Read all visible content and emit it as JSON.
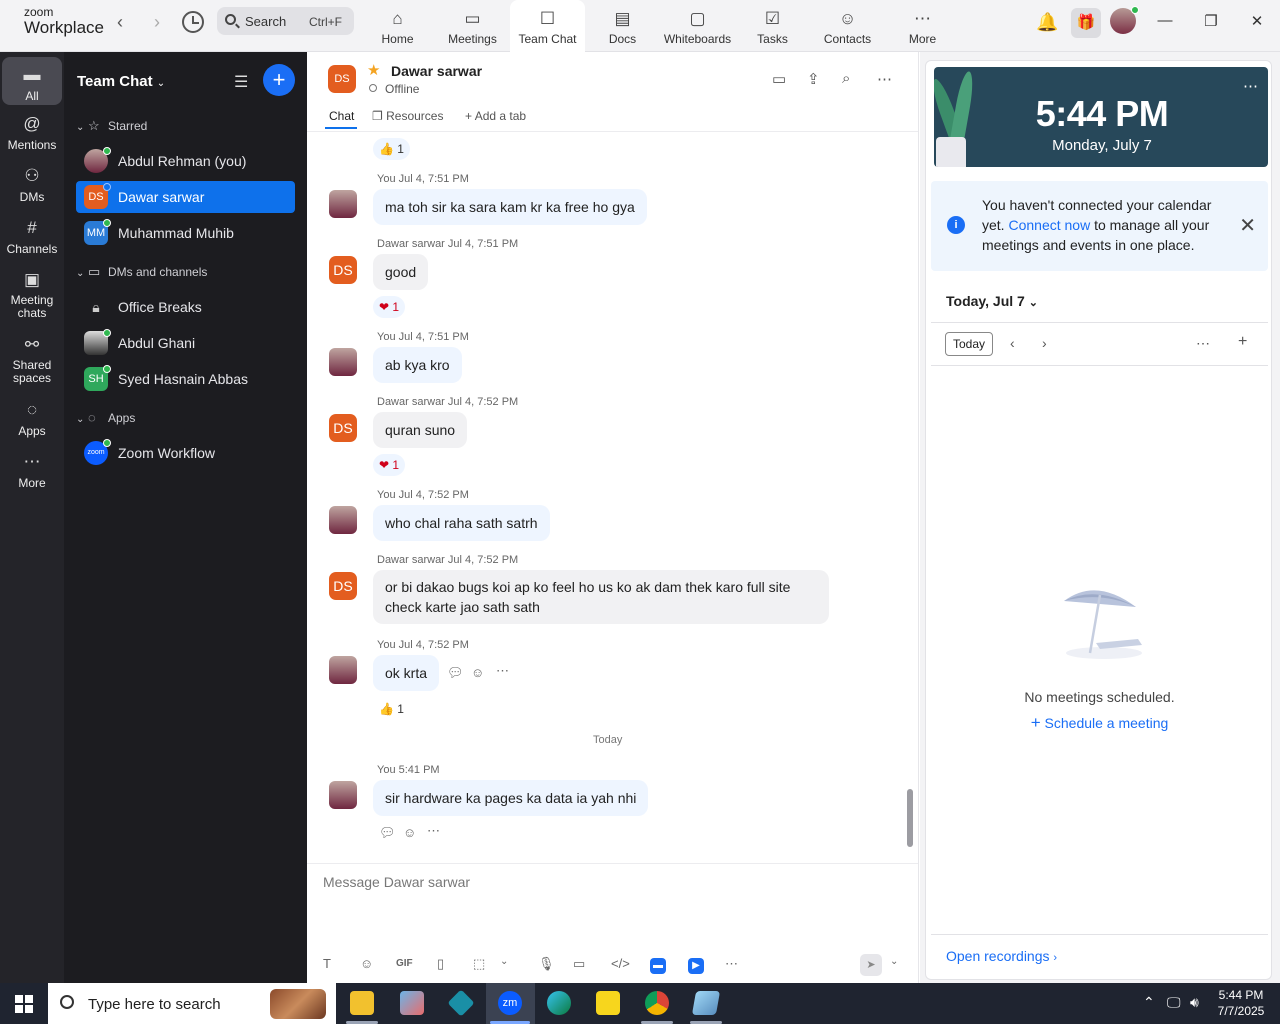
{
  "app": {
    "logo_line1": "zoom",
    "logo_line2": "Workplace"
  },
  "search": {
    "label": "Search",
    "shortcut": "Ctrl+F"
  },
  "topnav": [
    {
      "label": "Home",
      "icon": "home-icon"
    },
    {
      "label": "Meetings",
      "icon": "video-icon"
    },
    {
      "label": "Team Chat",
      "icon": "chat-icon",
      "active": true
    },
    {
      "label": "Docs",
      "icon": "doc-icon"
    },
    {
      "label": "Whiteboards",
      "icon": "whiteboard-icon"
    },
    {
      "label": "Tasks",
      "icon": "tasks-icon"
    },
    {
      "label": "Contacts",
      "icon": "contacts-icon"
    },
    {
      "label": "More",
      "icon": "more-icon"
    }
  ],
  "rail": [
    {
      "label": "All",
      "icon": "chat-bubble-icon",
      "active": true
    },
    {
      "label": "Mentions",
      "icon": "at-icon"
    },
    {
      "label": "DMs",
      "icon": "people-icon"
    },
    {
      "label": "Channels",
      "icon": "hash-icon"
    },
    {
      "label": "Meeting chats",
      "icon": "calendar-icon"
    },
    {
      "label": "Shared spaces",
      "icon": "share-icon"
    },
    {
      "label": "Apps",
      "icon": "apps-icon"
    },
    {
      "label": "More",
      "icon": "ellipsis-icon"
    }
  ],
  "sidebar": {
    "title": "Team Chat",
    "sections": {
      "starred": "Starred",
      "dms": "DMs and channels",
      "apps": "Apps"
    },
    "starred_items": [
      {
        "name": "Abdul Rehman (you)",
        "initials": ""
      },
      {
        "name": "Dawar sarwar",
        "initials": "DS",
        "active": true
      },
      {
        "name": "Muhammad Muhib",
        "initials": "MM"
      }
    ],
    "dm_items": [
      {
        "name": "Office Breaks",
        "initials": ""
      },
      {
        "name": "Abdul Ghani",
        "initials": ""
      },
      {
        "name": "Syed Hasnain Abbas",
        "initials": "SH"
      }
    ],
    "app_items": [
      {
        "name": "Zoom Workflow",
        "initials": "zoom"
      }
    ]
  },
  "chat": {
    "header": {
      "initials": "DS",
      "name": "Dawar sarwar",
      "status": "Offline"
    },
    "tabs": {
      "chat": "Chat",
      "resources": "Resources",
      "add": "Add a tab"
    },
    "messages": [
      {
        "meta": "",
        "text": "",
        "reaction": "👍 1"
      },
      {
        "meta": "You Jul 4, 7:51 PM",
        "text": "ma toh sir ka sara kam kr ka free ho gya"
      },
      {
        "meta": "Dawar sarwar Jul 4, 7:51 PM",
        "text": "good",
        "reaction": "❤ 1"
      },
      {
        "meta": "You Jul 4, 7:51 PM",
        "text": "ab kya kro"
      },
      {
        "meta": "Dawar sarwar Jul 4, 7:52 PM",
        "text": "quran suno",
        "reaction": "❤ 1"
      },
      {
        "meta": "You Jul 4, 7:52 PM",
        "text": "who chal raha sath satrh"
      },
      {
        "meta": "Dawar sarwar Jul 4, 7:52 PM",
        "text": "or bi dakao bugs koi ap ko feel ho us ko ak dam thek karo full site check karte jao sath sath"
      },
      {
        "meta": "You Jul 4, 7:52 PM",
        "text": "ok krta",
        "reaction": "👍 1"
      },
      {
        "meta": "You 5:41 PM",
        "text": "sir hardware ka pages ka data ia yah nhi"
      }
    ],
    "day_separator": "Today",
    "composer_placeholder": "Message Dawar sarwar",
    "composer_gif": "GIF"
  },
  "calendar": {
    "time": "5:44 PM",
    "date": "Monday, July 7",
    "banner_before": "You haven't connected your calendar yet. ",
    "banner_link": "Connect now",
    "banner_after": " to manage all your meetings and events in one place.",
    "today_header": "Today, Jul 7",
    "today_button": "Today",
    "empty": "No meetings scheduled.",
    "schedule": "Schedule a meeting",
    "recordings": "Open recordings"
  },
  "taskbar": {
    "search_placeholder": "Type here to search",
    "time": "5:44 PM",
    "date": "7/7/2025"
  },
  "colors": {
    "accent": "#0e71eb",
    "ds_avatar": "#e35d1f",
    "online": "#2fb84f"
  }
}
